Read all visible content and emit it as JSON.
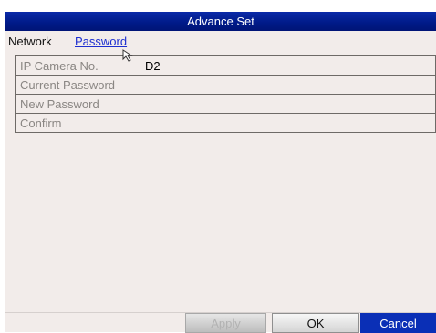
{
  "window": {
    "title": "Advance Set"
  },
  "tabs": [
    {
      "label": "Network"
    },
    {
      "label": "Password"
    }
  ],
  "form": {
    "rows": [
      {
        "label": "IP Camera No.",
        "value": "D2"
      },
      {
        "label": "Current Password",
        "value": ""
      },
      {
        "label": "New Password",
        "value": ""
      },
      {
        "label": "Confirm",
        "value": ""
      }
    ]
  },
  "buttons": {
    "apply": "Apply",
    "ok": "OK",
    "cancel": "Cancel"
  },
  "icons": {
    "cursor": "mouse-pointer-icon"
  },
  "colors": {
    "title_bar": "#001a87",
    "active_tab": "#1d2fd0",
    "cancel_button": "#0a2fb6"
  }
}
